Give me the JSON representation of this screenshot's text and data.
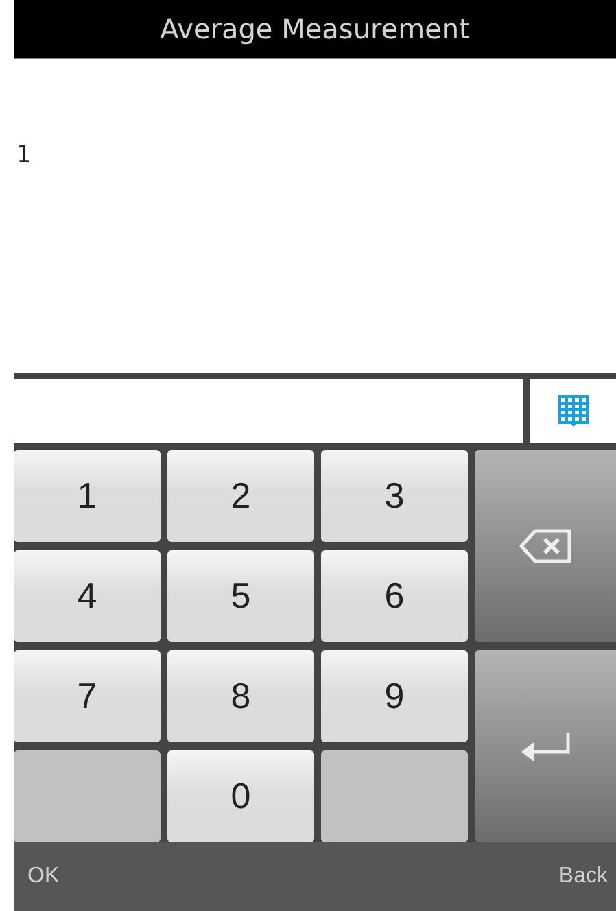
{
  "title": "Average Measurement",
  "content": "1",
  "keys": [
    {
      "kind": "digit",
      "label": "1"
    },
    {
      "kind": "digit",
      "label": "2"
    },
    {
      "kind": "digit",
      "label": "3"
    },
    {
      "kind": "backspace"
    },
    {
      "kind": "digit",
      "label": "4"
    },
    {
      "kind": "digit",
      "label": "5"
    },
    {
      "kind": "digit",
      "label": "6"
    },
    {
      "kind": "digit",
      "label": "7"
    },
    {
      "kind": "digit",
      "label": "8"
    },
    {
      "kind": "digit",
      "label": "9"
    },
    {
      "kind": "enter"
    },
    {
      "kind": "blank"
    },
    {
      "kind": "digit",
      "label": "0"
    },
    {
      "kind": "blank"
    }
  ],
  "softkeys": [
    "OK",
    "Back"
  ]
}
